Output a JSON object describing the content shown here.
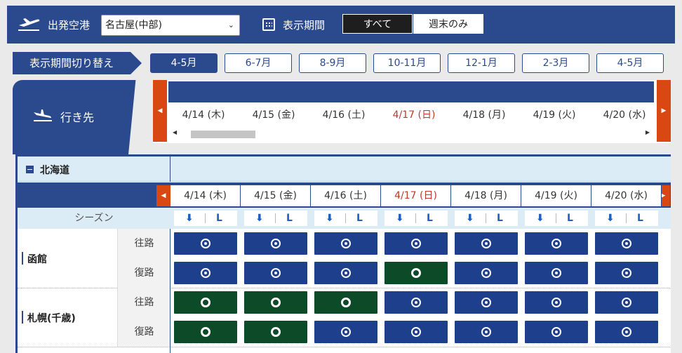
{
  "topbar": {
    "departure_label": "出発空港",
    "departure_value": "名古屋(中部)",
    "period_label": "表示期間",
    "seg_all": "すべて",
    "seg_weekend": "週末のみ"
  },
  "period_switch": {
    "label": "表示期間切り替え",
    "tabs": [
      "4-5月",
      "6-7月",
      "8-9月",
      "10-11月",
      "12-1月",
      "2-3月",
      "4-5月"
    ],
    "active_index": 0
  },
  "destination_header": "行き先",
  "dates": [
    {
      "label": "4/14 (木)",
      "sunday": false
    },
    {
      "label": "4/15 (金)",
      "sunday": false
    },
    {
      "label": "4/16 (土)",
      "sunday": false
    },
    {
      "label": "4/17 (日)",
      "sunday": true
    },
    {
      "label": "4/18 (月)",
      "sunday": false
    },
    {
      "label": "4/19 (火)",
      "sunday": false
    },
    {
      "label": "4/20 (水)",
      "sunday": false
    }
  ],
  "region": "北海道",
  "season": {
    "label": "シーズン",
    "icon_a": "⬇",
    "icon_b": "L"
  },
  "legs": {
    "outbound": "往路",
    "return": "復路"
  },
  "destinations": [
    {
      "name": "函館",
      "outbound": [
        "b",
        "b",
        "b",
        "b",
        "b",
        "b",
        "b"
      ],
      "return": [
        "b",
        "b",
        "b",
        "g",
        "b",
        "b",
        "b"
      ]
    },
    {
      "name": "札幌(千歳)",
      "outbound": [
        "g",
        "g",
        "g",
        "b",
        "b",
        "b",
        "b"
      ],
      "return": [
        "g",
        "g",
        "b",
        "b",
        "b",
        "b",
        "b"
      ]
    }
  ],
  "colors": {
    "navy": "#2b4a8e",
    "cell_blue": "#1e3f8c",
    "cell_green": "#0d4a28",
    "nav_orange": "#d94812",
    "sunday": "#c0392b"
  }
}
